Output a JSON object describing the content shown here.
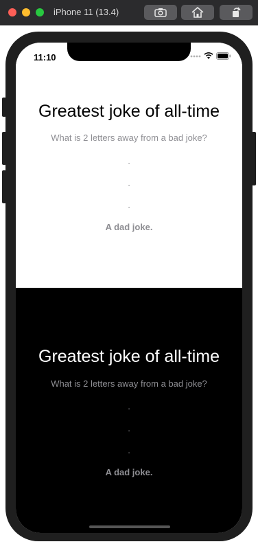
{
  "window": {
    "title": "iPhone 11 (13.4)",
    "toolbar": [
      {
        "icon": "screenshot-icon"
      },
      {
        "icon": "home-icon"
      },
      {
        "icon": "rotate-icon"
      }
    ]
  },
  "status_bar": {
    "time": "11:10"
  },
  "light_section": {
    "title": "Greatest joke of all-time",
    "question": "What is 2 letters away from a bad joke?",
    "dots": [
      ".",
      ".",
      "."
    ],
    "answer": "A dad joke."
  },
  "dark_section": {
    "title": "Greatest joke of all-time",
    "question": "What is 2 letters away from a bad joke?",
    "dots": [
      ".",
      ".",
      "."
    ],
    "answer": "A dad joke."
  },
  "colors": {
    "light_bg": "#ffffff",
    "dark_bg": "#000000",
    "secondary_text": "#8e8e93"
  }
}
